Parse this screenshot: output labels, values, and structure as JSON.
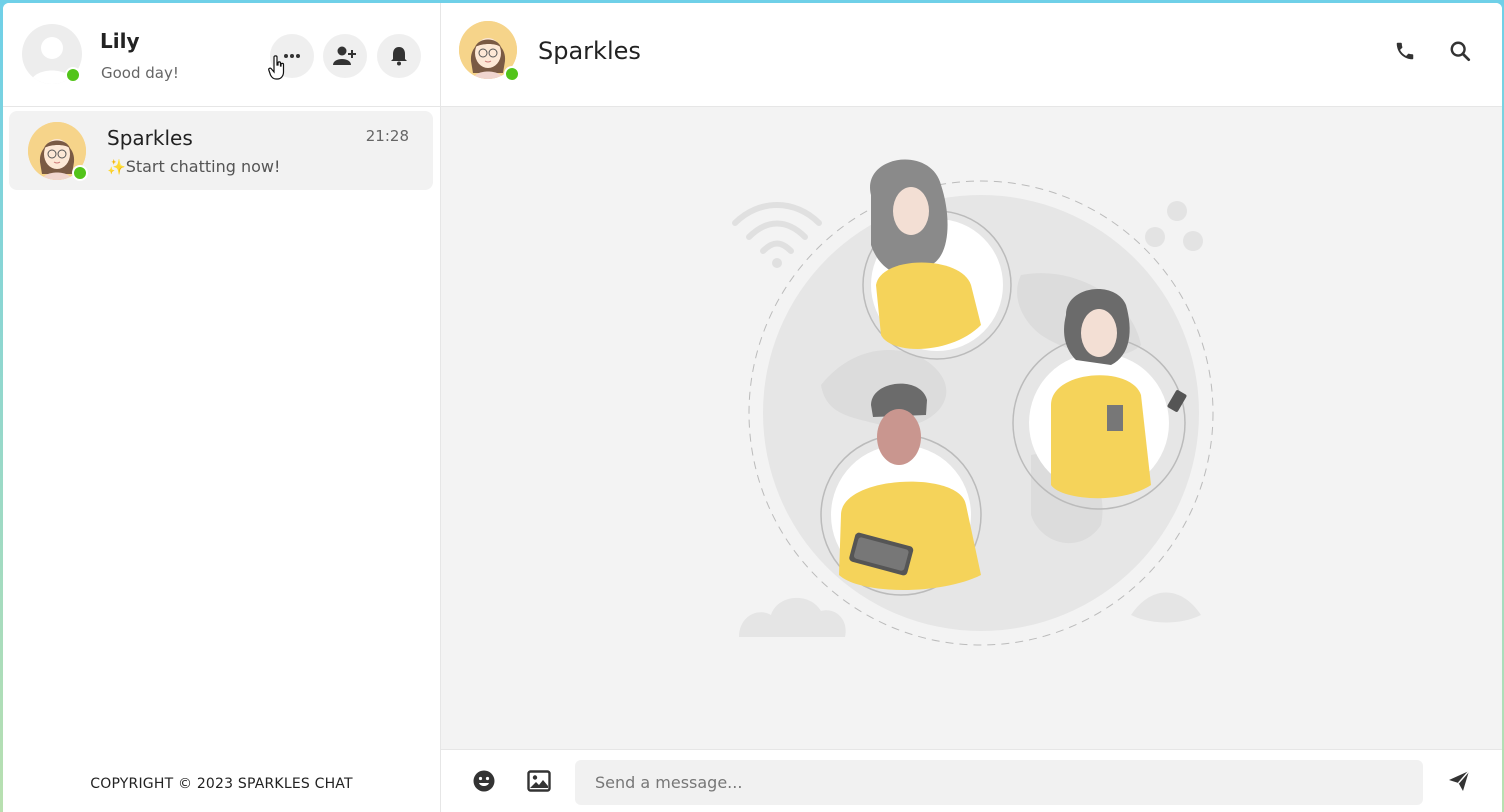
{
  "user": {
    "name": "Lily",
    "status": "Good day!"
  },
  "header_buttons": [
    "more-icon",
    "add-user-icon",
    "bell-icon"
  ],
  "conversations": [
    {
      "name": "Sparkles",
      "time": "21:28",
      "preview": "Start chatting now!",
      "preview_emoji": "✨"
    }
  ],
  "footer": {
    "copyright": "COPYRIGHT © 2023 SPARKLES CHAT"
  },
  "chat": {
    "title": "Sparkles",
    "header_icons": [
      "phone-icon",
      "search-icon"
    ]
  },
  "composer": {
    "placeholder": "Send a message...",
    "icons": [
      "emoji-icon",
      "image-icon",
      "send-icon"
    ]
  },
  "colors": {
    "online": "#52c41a",
    "accent_yellow": "#f5d35a",
    "frame_gradient_top": "#6fd0e8",
    "frame_gradient_bottom": "#b9e0b0"
  }
}
